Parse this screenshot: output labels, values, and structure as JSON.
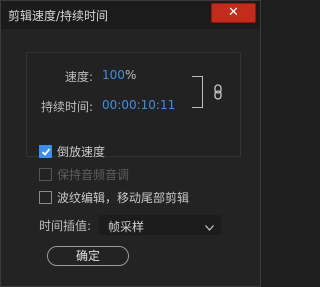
{
  "window": {
    "title": "剪辑速度/持续时间",
    "close_icon": "x"
  },
  "speed": {
    "label": "速度:",
    "value": "100",
    "unit": "%"
  },
  "duration": {
    "label": "持续时间:",
    "value": "00:00:10:11"
  },
  "link": {
    "icon": "chain-link-icon"
  },
  "options": {
    "reverse_speed": {
      "label": "倒放速度",
      "checked": true
    },
    "maintain_pitch": {
      "label": "保持音频音调",
      "checked": false,
      "disabled": true
    },
    "ripple_edit": {
      "label": "波纹编辑，移动尾部剪辑",
      "checked": false
    }
  },
  "time_interpolation": {
    "label": "时间插值:",
    "selected": "帧采样"
  },
  "ok_button": {
    "label": "确定"
  },
  "colors": {
    "accent": "#3b8eea",
    "value_blue": "#3d8fe0",
    "close_red": "#c42b1c",
    "background": "#232323"
  }
}
